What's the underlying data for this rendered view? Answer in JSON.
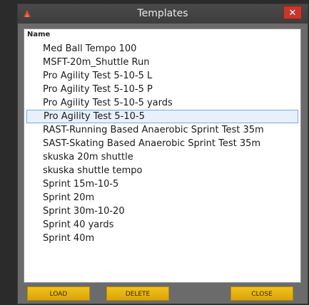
{
  "window": {
    "title": "Templates",
    "close_glyph": "✕",
    "app_icon": "app-logo-icon"
  },
  "list": {
    "column_header": "Name",
    "items": [
      "Med Ball Tempo 100",
      "MSFT-20m_Shuttle Run",
      "Pro Agility Test 5-10-5 L",
      "Pro Agility Test 5-10-5 P",
      "Pro Agility Test 5-10-5 yards",
      "Pro Agility Test 5-10-5",
      "RAST-Running Based Anaerobic Sprint Test 35m",
      "SAST-Skating Based Anaerobic Sprint Test 35m",
      "skuska 20m shuttle",
      "skuska shuttle tempo",
      "Sprint 15m-10-5",
      "Sprint 20m",
      "Sprint 30m-10-20",
      "Sprint 40 yards",
      "Sprint 40m"
    ],
    "selected_item": "Pro Agility Test 5-10-5"
  },
  "buttons": {
    "load": "LOAD",
    "delete": "DELETE",
    "close": "CLOSE"
  },
  "colors": {
    "titlebar": "#3d3d3d",
    "close_button": "#c8362b",
    "action_button": "#e8b512",
    "selection_border": "#7aa7dd",
    "selection_fill": "#e8f0fb"
  }
}
